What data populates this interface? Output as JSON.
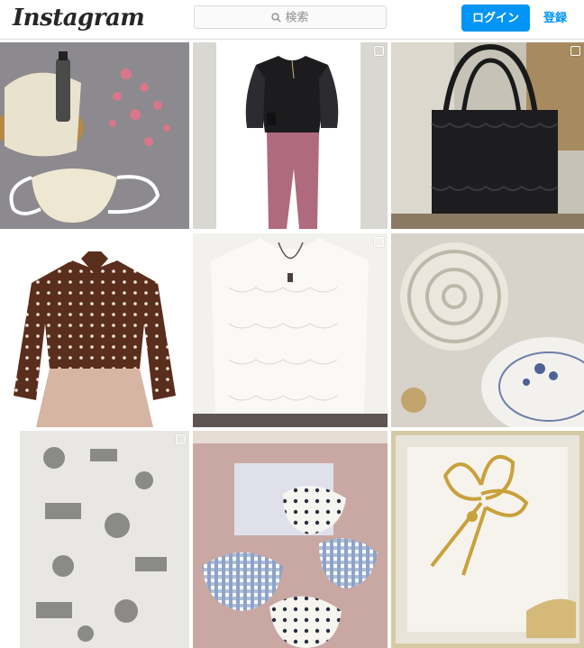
{
  "app": {
    "logo_text": "Instagram"
  },
  "header": {
    "search": {
      "icon": "search-icon",
      "placeholder": "検索"
    },
    "login_label": "ログイン",
    "signup_label": "登録",
    "accent_color": "#0095f6"
  },
  "posts": [
    {
      "subject": "lace-masks-basket",
      "multi": false
    },
    {
      "subject": "black-lace-sleeve-top-pink-pants",
      "multi": true
    },
    {
      "subject": "black-ruffle-tote-bag",
      "multi": true
    },
    {
      "subject": "brown-polka-dot-blouse",
      "multi": false
    },
    {
      "subject": "white-lace-blouse",
      "multi": true
    },
    {
      "subject": "white-trivet-and-plate",
      "multi": false
    },
    {
      "subject": "toile-fabric",
      "multi": true
    },
    {
      "subject": "gingham-and-dot-masks",
      "multi": false
    },
    {
      "subject": "gold-ribbon-brooch",
      "multi": false
    }
  ]
}
